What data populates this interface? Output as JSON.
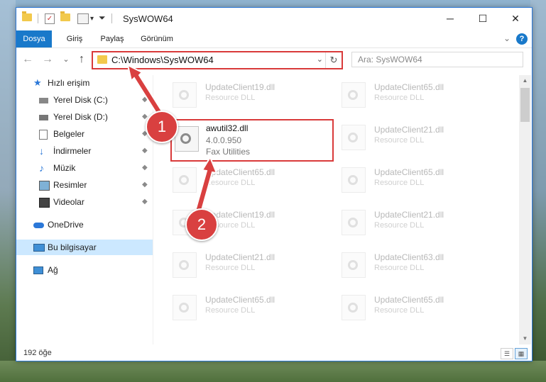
{
  "window": {
    "title": "SysWOW64",
    "minimize": "─",
    "maximize": "☐",
    "close": "✕"
  },
  "ribbon": {
    "tabs": [
      "Dosya",
      "Giriş",
      "Paylaş",
      "Görünüm"
    ],
    "expand": "⌄",
    "help": "?"
  },
  "nav": {
    "back": "←",
    "forward": "→",
    "recent": "⌄",
    "up": "↑",
    "address": "C:\\Windows\\SysWOW64",
    "address_dropdown": "⌄",
    "refresh": "↻",
    "search_placeholder": "Ara: SysWOW64"
  },
  "sidebar": {
    "items": [
      {
        "label": "Hızlı erişim",
        "icon": "star-icon"
      },
      {
        "label": "Yerel Disk (C:)",
        "icon": "drive-icon"
      },
      {
        "label": "Yerel Disk (D:)",
        "icon": "drive-icon"
      },
      {
        "label": "Belgeler",
        "icon": "documents-icon"
      },
      {
        "label": "İndirmeler",
        "icon": "downloads-icon"
      },
      {
        "label": "Müzik",
        "icon": "music-icon"
      },
      {
        "label": "Resimler",
        "icon": "pictures-icon"
      },
      {
        "label": "Videolar",
        "icon": "videos-icon"
      },
      {
        "label": "OneDrive",
        "icon": "cloud-icon"
      },
      {
        "label": "Bu bilgisayar",
        "icon": "computer-icon"
      },
      {
        "label": "Ağ",
        "icon": "network-icon"
      }
    ],
    "pin": "📌"
  },
  "files": [
    {
      "name": "UpdateClient19.dll",
      "desc": "Resource DLL"
    },
    {
      "name": "UpdateClient65.dll",
      "desc": "Resource DLL"
    },
    {
      "name": "UpdateClient21.dll",
      "desc": "Resource DLL"
    },
    {
      "name": "UpdateClient65.dll",
      "desc": "Resource DLL"
    },
    {
      "name": "UpdateClient65.dll",
      "desc": "Resource DLL"
    },
    {
      "name": "UpdateClient19.dll",
      "desc": "Resource DLL"
    },
    {
      "name": "UpdateClient21.dll",
      "desc": "Resource DLL"
    },
    {
      "name": "UpdateClient21.dll",
      "desc": "Resource DLL"
    },
    {
      "name": "UpdateClient63.dll",
      "desc": "Resource DLL"
    },
    {
      "name": "UpdateClient65.dll",
      "desc": "Resource DLL"
    },
    {
      "name": "UpdateClient65.dll",
      "desc": "Resource DLL"
    }
  ],
  "highlighted_file": {
    "name": "awutil32.dll",
    "version": "4.0.0.950",
    "description": "Fax Utilities"
  },
  "status": {
    "count": "192 öğe"
  },
  "annotations": {
    "badge1": "1",
    "badge2": "2",
    "color": "#d94040"
  }
}
